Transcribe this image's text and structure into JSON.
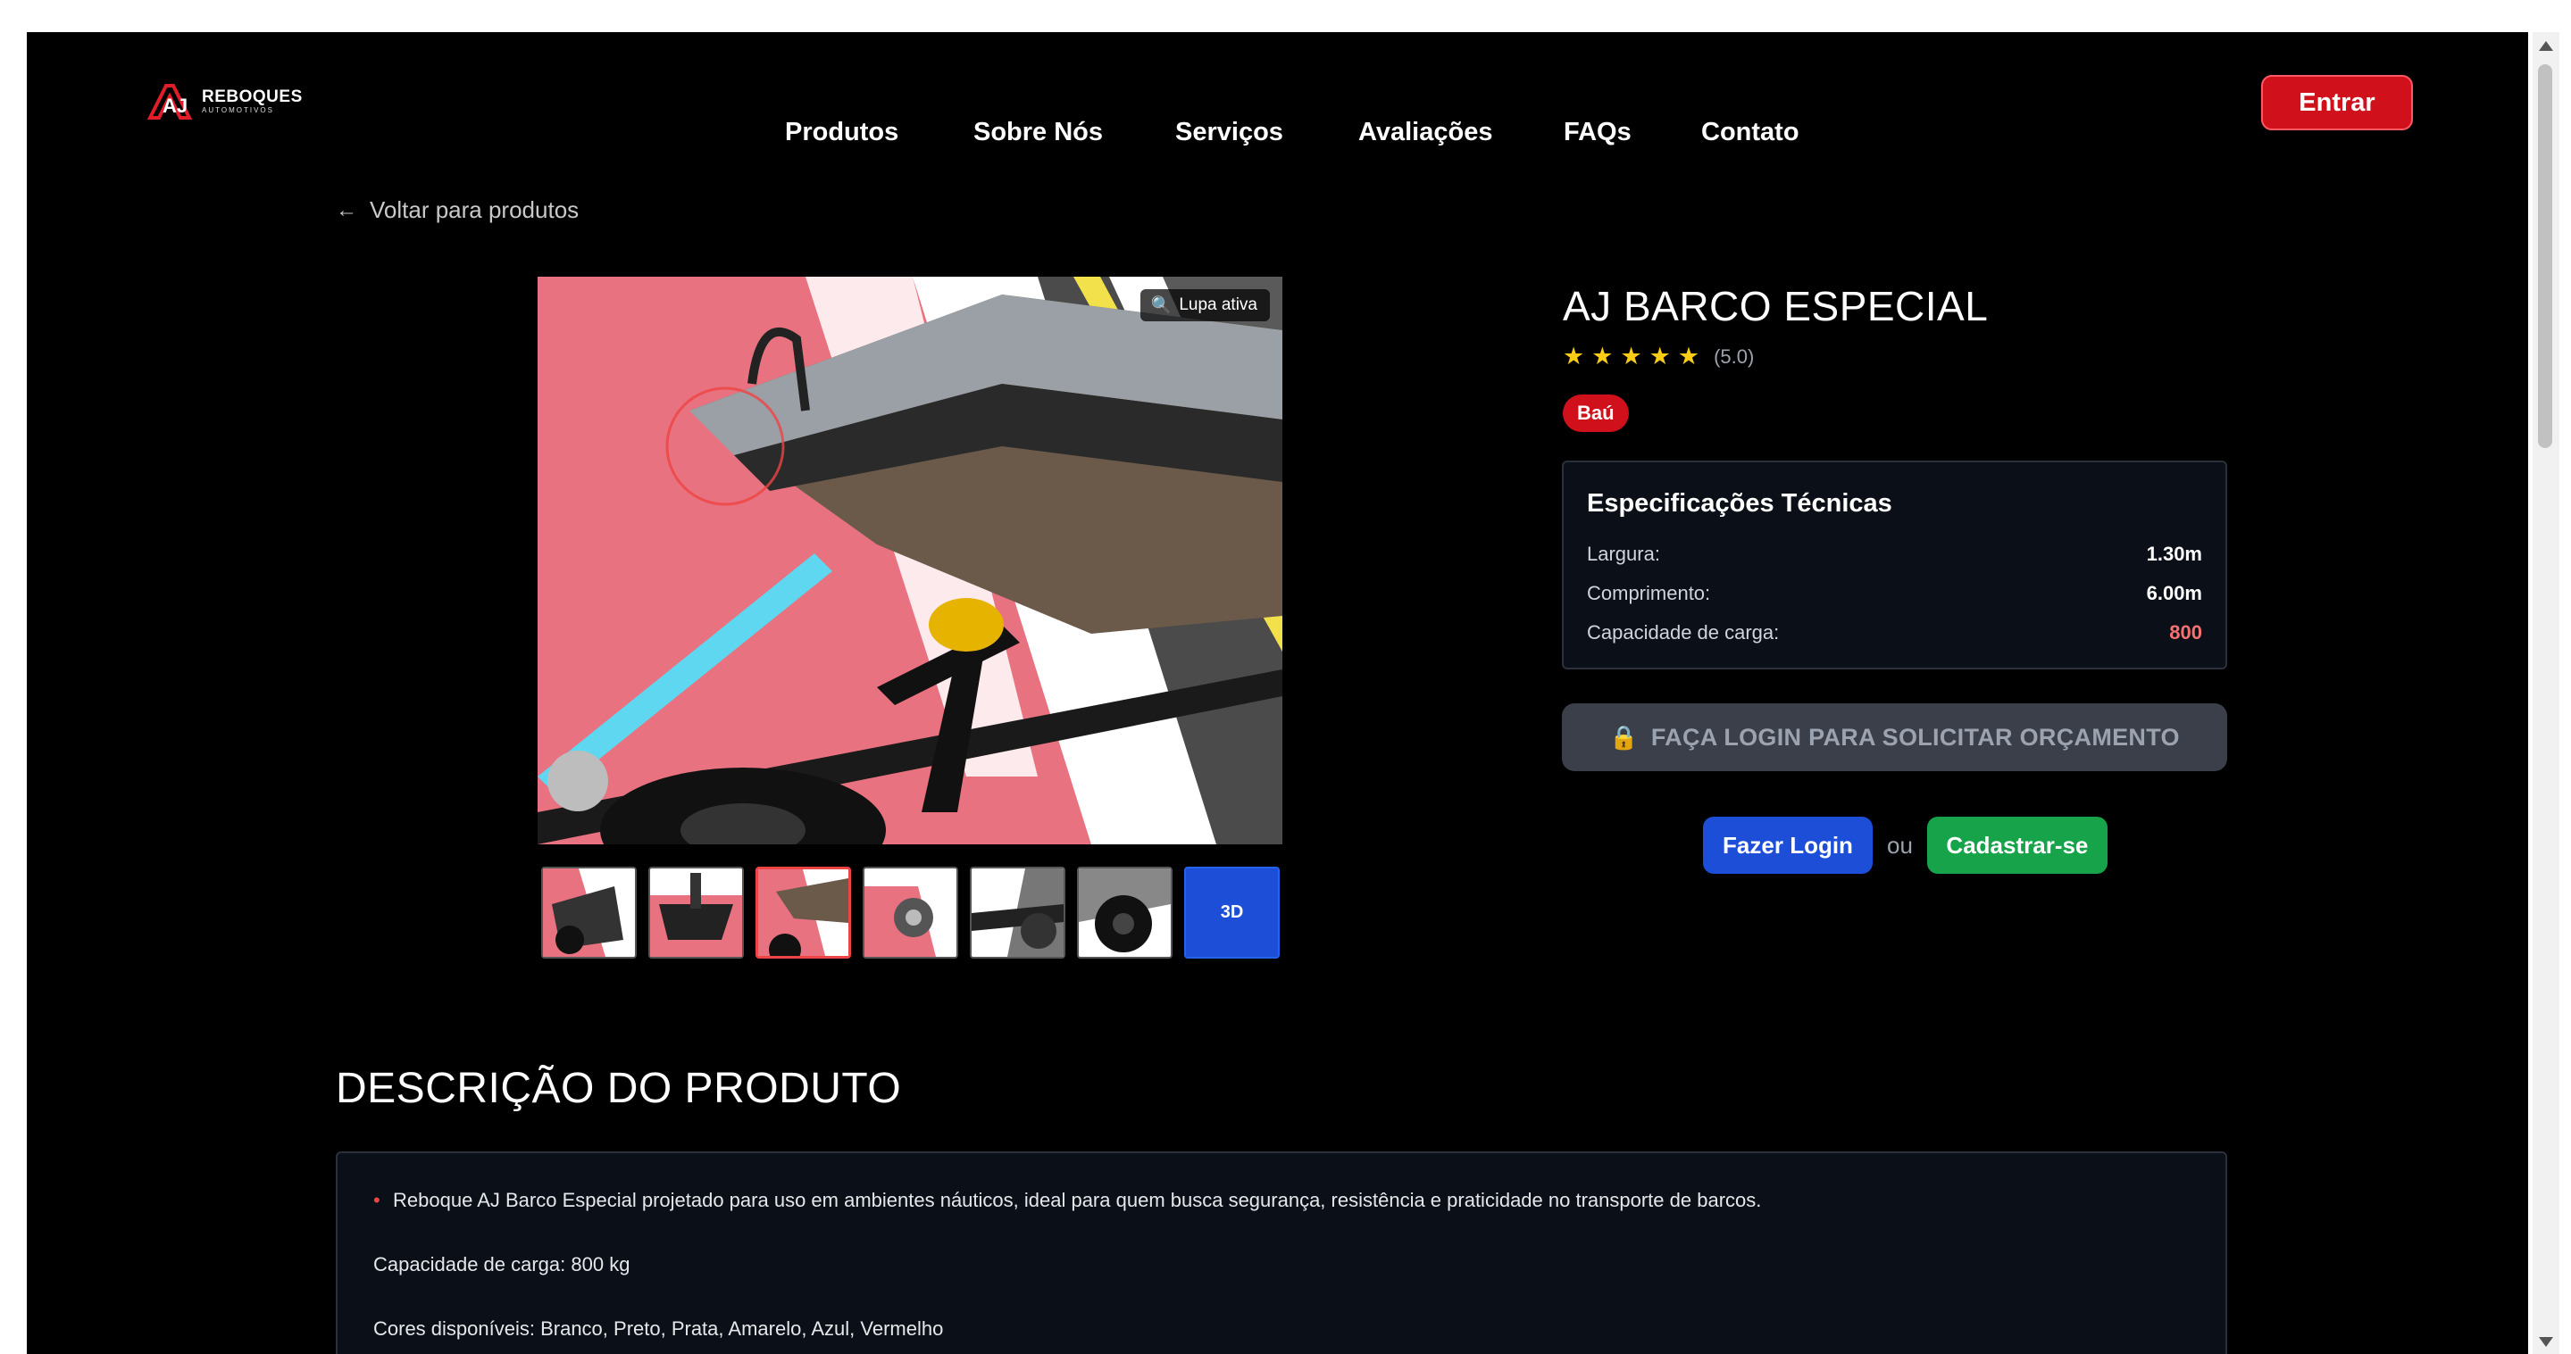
{
  "header": {
    "logo": {
      "line1": "REBOQUES",
      "line2": "AUTOMOTIVOS"
    },
    "nav": [
      "Produtos",
      "Sobre Nós",
      "Serviços",
      "Avaliações",
      "FAQs",
      "Contato"
    ],
    "login_button": "Entrar"
  },
  "back_link": "Voltar para produtos",
  "gallery": {
    "zoom_badge": "Lupa ativa",
    "thumbnail_count": 6,
    "active_thumbnail": 3,
    "three_d_label": "3D"
  },
  "product": {
    "title": "AJ BARCO ESPECIAL",
    "rating_text": "(5.0)",
    "rating_stars": 5,
    "category": "Baú",
    "specs": {
      "heading": "Especificações Técnicas",
      "rows": [
        {
          "label": "Largura:",
          "value": "1.30m"
        },
        {
          "label": "Comprimento:",
          "value": "6.00m"
        },
        {
          "label": "Capacidade de carga:",
          "value": "800"
        }
      ]
    },
    "login_required": "FAÇA LOGIN PARA SOLICITAR ORÇAMENTO",
    "login_button": "Fazer Login",
    "or_text": "ou",
    "register_button": "Cadastrar-se"
  },
  "description": {
    "heading": "DESCRIÇÃO DO PRODUTO",
    "lines": [
      "Reboque AJ Barco Especial projetado para uso em ambientes náuticos, ideal para quem busca segurança, resistência e praticidade no transporte de barcos.",
      "Capacidade de carga: 800 kg",
      "Cores disponíveis: Branco, Preto, Prata, Amarelo, Azul, Vermelho"
    ]
  },
  "colors": {
    "brand_red": "#d0101b",
    "login_blue": "#1d4ed8",
    "register_green": "#16a34a",
    "star_yellow": "#facc15"
  }
}
